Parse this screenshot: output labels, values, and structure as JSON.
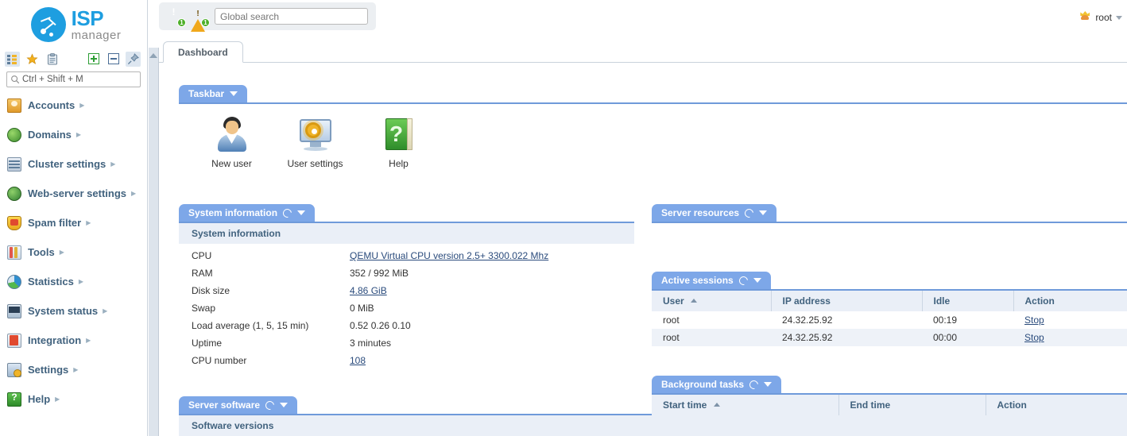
{
  "brand": {
    "name_primary": "ISP",
    "name_secondary": "manager"
  },
  "sidebar": {
    "toolbar": [
      {
        "name": "tree-view-icon",
        "glyph": "▤"
      },
      {
        "name": "favorites-star-icon",
        "glyph": "★"
      },
      {
        "name": "clipboard-icon",
        "glyph": "📋"
      },
      {
        "name": "expand-all-icon",
        "glyph": "＋"
      },
      {
        "name": "collapse-all-icon",
        "glyph": "－"
      },
      {
        "name": "pin-icon",
        "glyph": "📌"
      }
    ],
    "search": {
      "placeholder": "Ctrl + Shift + M",
      "value": ""
    },
    "items": [
      {
        "label": "Accounts",
        "icon": "accounts-icon"
      },
      {
        "label": "Domains",
        "icon": "domains-icon"
      },
      {
        "label": "Cluster settings",
        "icon": "cluster-icon"
      },
      {
        "label": "Web-server settings",
        "icon": "webserver-icon"
      },
      {
        "label": "Spam filter",
        "icon": "spam-filter-icon"
      },
      {
        "label": "Tools",
        "icon": "tools-icon"
      },
      {
        "label": "Statistics",
        "icon": "statistics-icon"
      },
      {
        "label": "System status",
        "icon": "system-status-icon"
      },
      {
        "label": "Integration",
        "icon": "integration-icon"
      },
      {
        "label": "Settings",
        "icon": "settings-icon"
      },
      {
        "label": "Help",
        "icon": "help-icon"
      }
    ]
  },
  "topbar": {
    "error_count": "1",
    "warning_count": "1",
    "search": {
      "placeholder": "Global search",
      "value": ""
    },
    "user": "root"
  },
  "tabs": [
    {
      "label": "Dashboard",
      "active": true
    }
  ],
  "taskbar": {
    "title": "Taskbar",
    "items": [
      {
        "label": "New user",
        "icon": "new-user-icon"
      },
      {
        "label": "User settings",
        "icon": "user-settings-icon"
      },
      {
        "label": "Help",
        "icon": "help-book-icon"
      }
    ]
  },
  "system_information": {
    "title": "System information",
    "subhead": "System information",
    "rows": [
      {
        "key": "CPU",
        "value": "QEMU Virtual CPU version 2.5+ 3300.022 Mhz",
        "link": true
      },
      {
        "key": "RAM",
        "value": "352 / 992 MiB",
        "link": false
      },
      {
        "key": "Disk size",
        "value": "4.86 GiB",
        "link": true
      },
      {
        "key": "Swap",
        "value": "0 MiB",
        "link": false
      },
      {
        "key": "Load average (1, 5, 15 min)",
        "value": "0.52 0.26 0.10",
        "link": false
      },
      {
        "key": "Uptime",
        "value": "3 minutes",
        "link": false
      },
      {
        "key": "CPU number",
        "value": "108",
        "link": true
      }
    ]
  },
  "server_software": {
    "title": "Server software",
    "subhead": "Software versions"
  },
  "server_resources": {
    "title": "Server resources"
  },
  "active_sessions": {
    "title": "Active sessions",
    "columns": [
      "User",
      "IP address",
      "Idle",
      "Action"
    ],
    "sort_column": "User",
    "rows": [
      {
        "user": "root",
        "ip": "24.32.25.92",
        "idle": "00:19",
        "action": "Stop"
      },
      {
        "user": "root",
        "ip": "24.32.25.92",
        "idle": "00:00",
        "action": "Stop"
      }
    ]
  },
  "background_tasks": {
    "title": "Background tasks",
    "columns": [
      "Start time",
      "End time",
      "Action"
    ],
    "sort_column": "Start time",
    "rows": []
  },
  "colors": {
    "accent": "#7da7e8",
    "brand": "#1e9ee0",
    "link": "#2a4b7c",
    "subhead_bg": "#eaeff7"
  }
}
